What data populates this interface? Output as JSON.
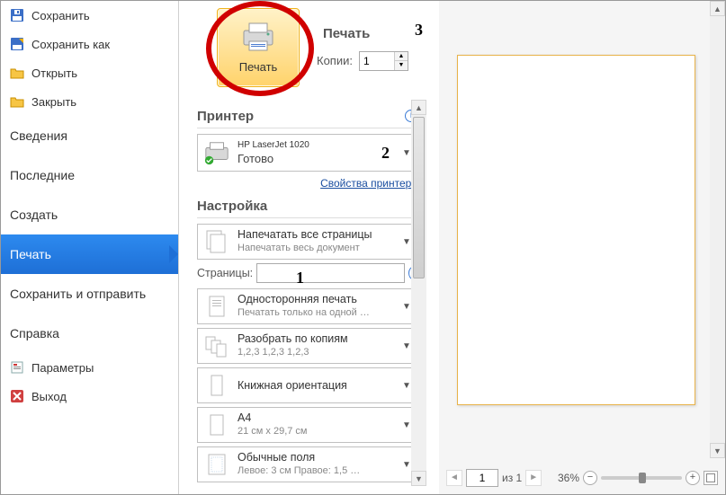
{
  "sidebar": {
    "save": "Сохранить",
    "saveAs": "Сохранить как",
    "open": "Открыть",
    "close": "Закрыть",
    "info": "Сведения",
    "recent": "Последние",
    "create": "Создать",
    "print": "Печать",
    "saveSend": "Сохранить и отправить",
    "help": "Справка",
    "options": "Параметры",
    "exit": "Выход"
  },
  "print": {
    "title": "Печать",
    "buttonLabel": "Печать",
    "copiesLabel": "Копии:",
    "copiesValue": "1"
  },
  "printer": {
    "title": "Принтер",
    "name": "HP LaserJet 1020",
    "status": "Готово",
    "propsLink": "Свойства принтера"
  },
  "settings": {
    "title": "Настройка",
    "range": {
      "main": "Напечатать все страницы",
      "sub": "Напечатать весь документ"
    },
    "pagesLabel": "Страницы:",
    "pagesValue": "",
    "duplex": {
      "main": "Односторонняя печать",
      "sub": "Печатать только на одной …"
    },
    "collate": {
      "main": "Разобрать по копиям",
      "sub": "1,2,3   1,2,3   1,2,3"
    },
    "orientation": {
      "main": "Книжная ориентация",
      "sub": ""
    },
    "paper": {
      "main": "A4",
      "sub": "21 см x 29,7 см"
    },
    "margins": {
      "main": "Обычные поля",
      "sub": "Левое: 3 см   Правое: 1,5 …"
    }
  },
  "status": {
    "pageField": "1",
    "pageOf": "из 1",
    "zoom": "36%"
  },
  "annotations": {
    "a1": "1",
    "a2": "2",
    "a3": "3"
  }
}
